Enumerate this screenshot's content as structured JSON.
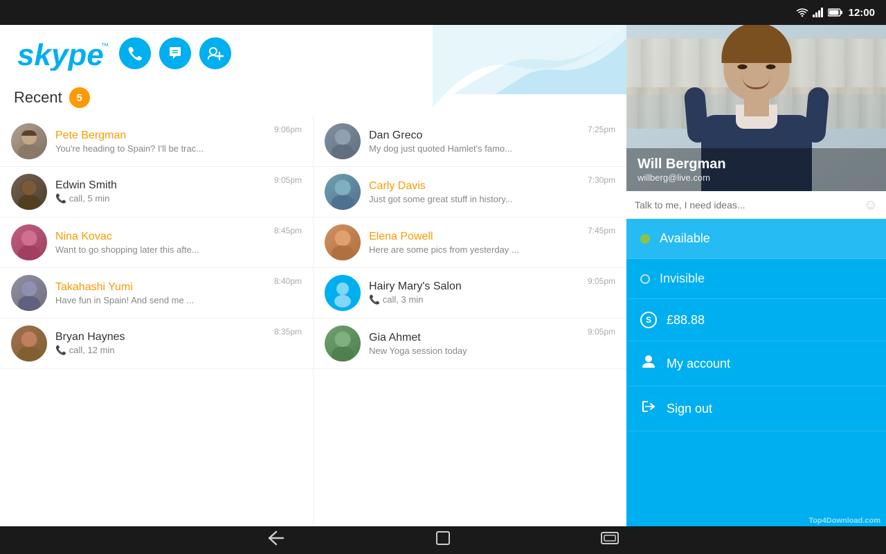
{
  "statusBar": {
    "time": "12:00",
    "icons": [
      "wifi",
      "signal",
      "battery"
    ]
  },
  "header": {
    "logoText": "skype",
    "callBtn": "📞",
    "chatBtn": "💬",
    "addBtn": "➕"
  },
  "recent": {
    "label": "Recent",
    "count": "5"
  },
  "contacts": {
    "left": [
      {
        "name": "Pete Bergman",
        "nameColor": "orange",
        "preview": "You're heading to Spain? I'll be trac...",
        "time": "9:06pm",
        "avatarClass": "avatar-pete",
        "avatarChar": "👤"
      },
      {
        "name": "Edwin Smith",
        "nameColor": "normal",
        "preview": "📞 call, 5 min",
        "time": "9:05pm",
        "avatarClass": "avatar-edwin",
        "avatarChar": "👤"
      },
      {
        "name": "Nina Kovac",
        "nameColor": "orange",
        "preview": "Want to go shopping later this afte...",
        "time": "8:45pm",
        "avatarClass": "avatar-nina",
        "avatarChar": "👤"
      },
      {
        "name": "Takahashi Yumi",
        "nameColor": "orange",
        "preview": "Have fun in Spain! And send me ...",
        "time": "8:40pm",
        "avatarClass": "avatar-takahashi",
        "avatarChar": "👤"
      },
      {
        "name": "Bryan Haynes",
        "nameColor": "normal",
        "preview": "📞 call, 12 min",
        "time": "8:35pm",
        "avatarClass": "avatar-bryan",
        "avatarChar": "👤"
      }
    ],
    "right": [
      {
        "name": "Dan Greco",
        "nameColor": "normal",
        "preview": "My dog just quoted Hamlet's famo...",
        "time": "7:25pm",
        "avatarClass": "avatar-dan",
        "avatarChar": "👤"
      },
      {
        "name": "Carly Davis",
        "nameColor": "orange",
        "preview": "Just got some great stuff in history...",
        "time": "7:30pm",
        "avatarClass": "avatar-carly",
        "avatarChar": "👤"
      },
      {
        "name": "Elena Powell",
        "nameColor": "orange",
        "preview": "Here are some pics from yesterday ...",
        "time": "7:45pm",
        "avatarClass": "avatar-elena",
        "avatarChar": "👤"
      },
      {
        "name": "Hairy Mary's Salon",
        "nameColor": "normal",
        "preview": "📞 call, 3 min",
        "time": "9:05pm",
        "avatarClass": "avatar-hairy",
        "avatarChar": "👤"
      },
      {
        "name": "Gia Ahmet",
        "nameColor": "normal",
        "preview": "New Yoga session today",
        "time": "9:05pm",
        "avatarClass": "avatar-gia",
        "avatarChar": "👤"
      }
    ]
  },
  "rightPanel": {
    "profileName": "Will Bergman",
    "profileEmail": "willberg@live.com",
    "moodPlaceholder": "Talk to me, I need ideas...",
    "availableLabel": "Available",
    "invisibleLabel": "Invisible",
    "creditLabel": "£88.88",
    "myAccountLabel": "My account",
    "signOutLabel": "Sign out"
  },
  "bottomNav": {
    "backBtn": "←",
    "homeBtn": "⬜",
    "recentBtn": "▭"
  },
  "watermark": "Top4Download.com"
}
